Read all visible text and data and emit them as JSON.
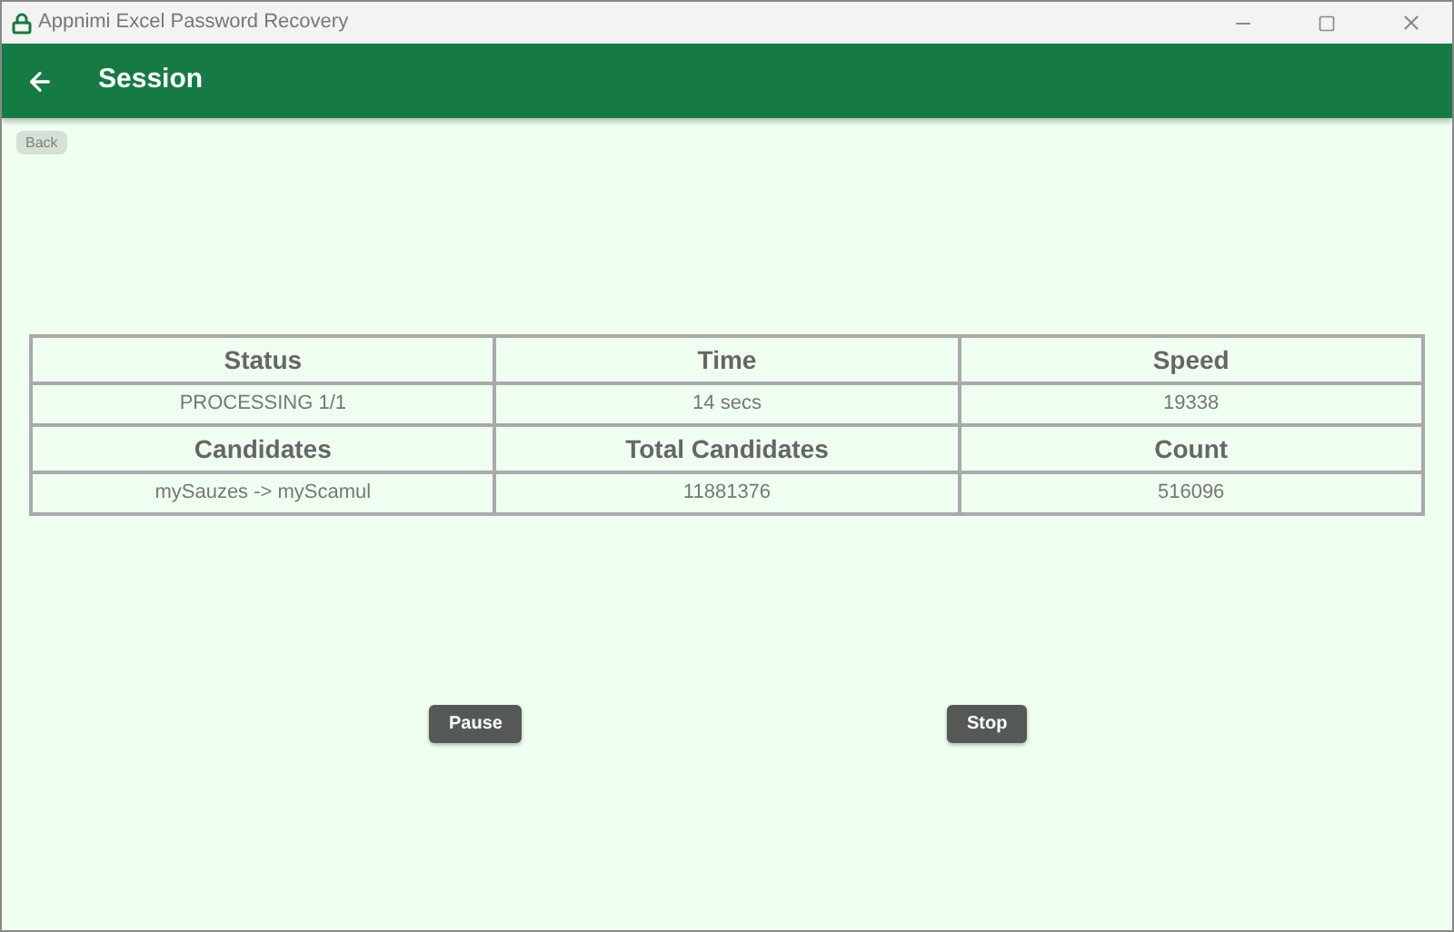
{
  "window": {
    "title": "Appnimi Excel Password Recovery"
  },
  "header": {
    "title": "Session",
    "back_tooltip": "Back"
  },
  "table": {
    "sections": [
      {
        "headings": [
          "Status",
          "Time",
          "Speed"
        ],
        "values": [
          "PROCESSING 1/1",
          "14 secs",
          "19338"
        ]
      },
      {
        "headings": [
          "Candidates",
          "Total Candidates",
          "Count"
        ],
        "values": [
          "mySauzes -> myScamul",
          "11881376",
          "516096"
        ]
      }
    ]
  },
  "buttons": [
    "Pause",
    "Stop"
  ]
}
